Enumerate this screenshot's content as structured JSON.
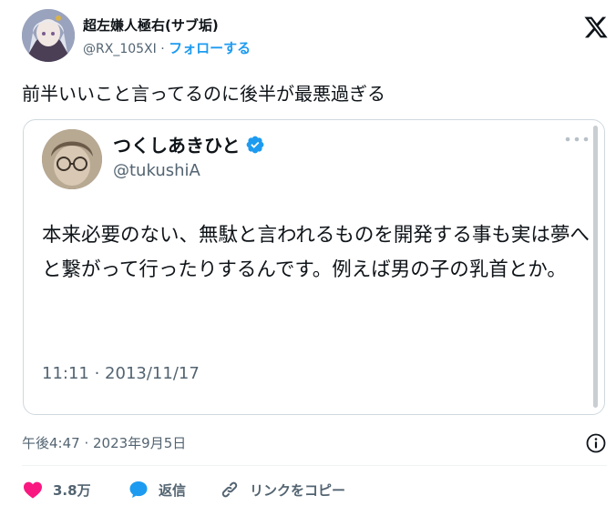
{
  "author": {
    "display_name": "超左嫌人極右(サブ垢)",
    "handle": "@RX_105XI",
    "separator": "·",
    "follow_label": "フォローする"
  },
  "tweet": {
    "text": "前半いいこと言ってるのに後半が最悪過ぎる",
    "timestamp": "午後4:47 · 2023年9月5日"
  },
  "quoted": {
    "display_name": "つくしあきひと",
    "handle": "@tukushiA",
    "text": "本来必要のない、無駄と言われるものを開発する事も実は夢へと繋がって行ったりするんです。例えば男の子の乳首とか。",
    "timestamp": "11:11 · 2013/11/17",
    "verified": true
  },
  "actions": {
    "like_count": "3.8万",
    "reply_label": "返信",
    "copy_link_label": "リンクをコピー"
  },
  "icons": {
    "logo": "x-logo-icon",
    "verified": "verified-badge-icon",
    "more": "more-dots-icon",
    "info": "info-icon",
    "like": "heart-icon",
    "reply": "speech-bubble-icon",
    "copy": "link-icon"
  },
  "colors": {
    "accent": "#1d9bf0",
    "like": "#f91880",
    "text_primary": "#0f1419",
    "text_secondary": "#536471",
    "border": "#cfd9de"
  }
}
